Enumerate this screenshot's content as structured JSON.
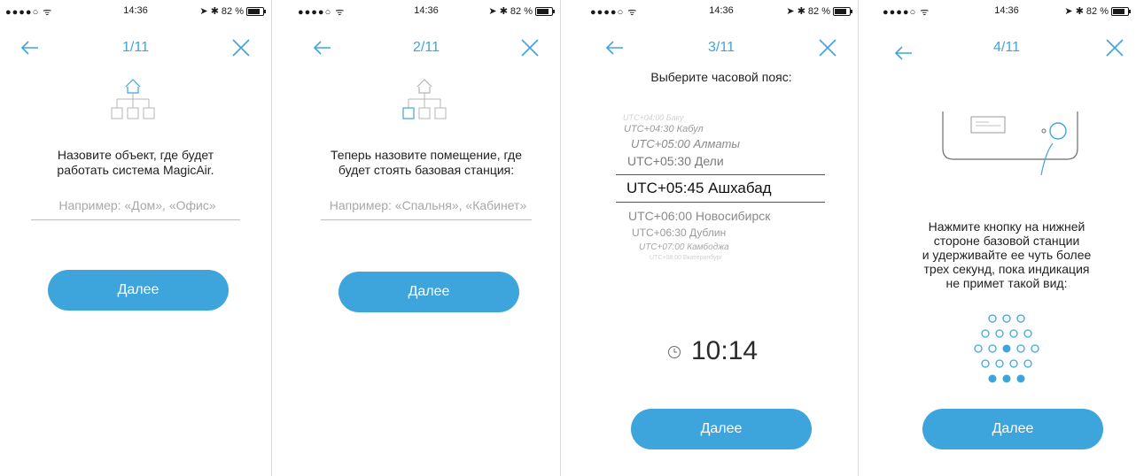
{
  "status": {
    "signal": "●●●●○",
    "time": "14:36",
    "battery": "82 %"
  },
  "next_label": "Далее",
  "screens": [
    {
      "counter": "1/11",
      "prompt_line1": "Назовите объект, где будет",
      "prompt_line2": "работать система MagicAir.",
      "placeholder": "Например: «Дом», «Офис»"
    },
    {
      "counter": "2/11",
      "prompt_line1": "Теперь назовите помещение, где",
      "prompt_line2": "будет стоять базовая станция:",
      "placeholder": "Например: «Спальня», «Кабинет»"
    },
    {
      "counter": "3/11",
      "title": "Выберите часовой пояс:",
      "timezones": [
        "UTC+04:00 Баку",
        "UTC+04:30 Кабул",
        "UTC+05:00 Алматы",
        "UTC+05:30 Дели",
        "UTC+05:45 Ашхабад",
        "UTC+06:00 Новосибирск",
        "UTC+06:30 Дублин",
        "UTC+07:00 Камбоджа",
        "UTC+08:00 Екатеринбург"
      ],
      "selected_index": 4,
      "clock": "10:14"
    },
    {
      "counter": "4/11",
      "instructions": [
        "Нажмите кнопку на нижней",
        "стороне базовой станции",
        "и удерживайте ее чуть более",
        "трех секунд, пока индикация",
        "не примет такой вид:"
      ]
    }
  ],
  "colors": {
    "accent": "#3ea5dc",
    "text": "#222222",
    "divider": "#bdbdbd"
  }
}
